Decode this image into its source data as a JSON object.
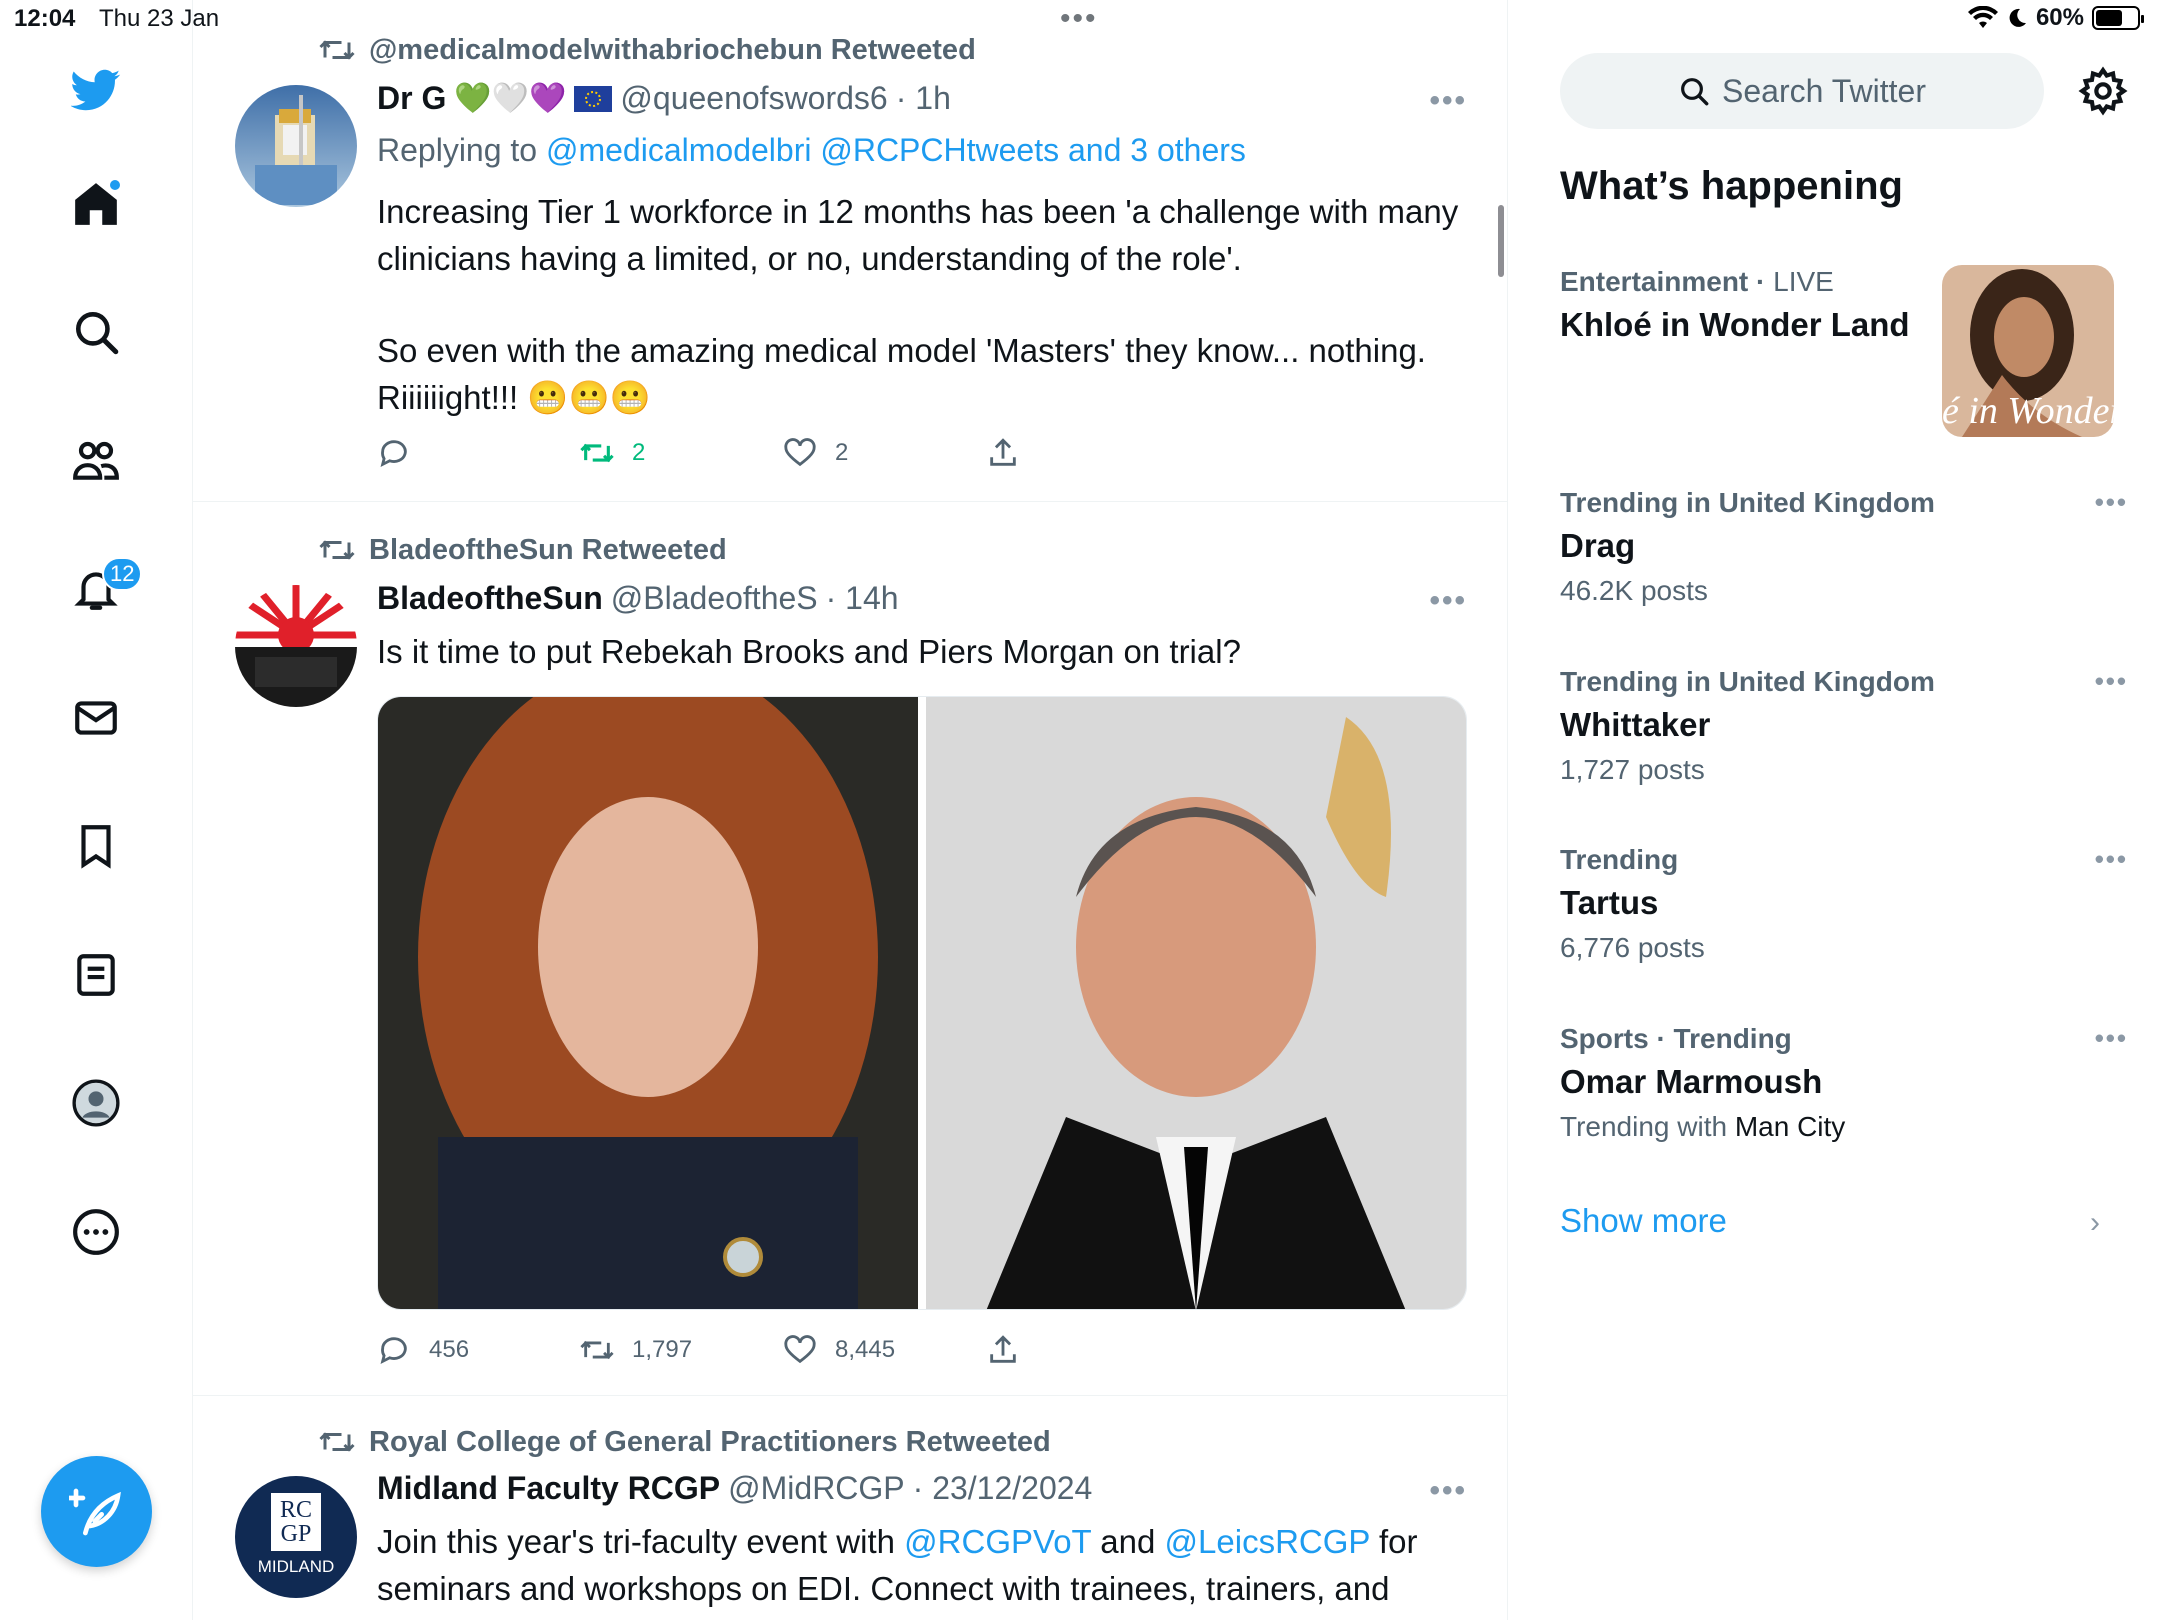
{
  "status_bar": {
    "time": "12:04",
    "date": "Thu 23 Jan",
    "battery": "60%"
  },
  "nav": {
    "notifications_badge": "12"
  },
  "tweets": [
    {
      "retweeted_by": "@medicalmodelwithabriochebun Retweeted",
      "name": "Dr G",
      "name_emoji": "💚🤍💜",
      "handle": "@queenofswords6",
      "time": "· 1h",
      "replying_prefix": "Replying to ",
      "replying_to": "@medicalmodelbri @RCPCHtweets and 3 others",
      "text_1": "Increasing Tier 1 workforce in 12 months has been 'a challenge with many clinicians having a limited, or no, understanding of the role'.",
      "text_2": "So even with the amazing medical model 'Masters' they know... nothing. Riiiiiight!!! 😬😬😬",
      "replies": "",
      "retweets": "2",
      "likes": "2"
    },
    {
      "retweeted_by": "BladeoftheSun Retweeted",
      "name": "BladeoftheSun",
      "handle": "@BladeoftheS",
      "time": "· 14h",
      "text": "Is it time to put Rebekah Brooks and Piers Morgan on trial?",
      "replies": "456",
      "retweets": "1,797",
      "likes": "8,445"
    },
    {
      "retweeted_by": "Royal College of General Practitioners Retweeted",
      "name": "Midland Faculty RCGP",
      "handle": "@MidRCGP",
      "time": "· 23/12/2024",
      "text_a": "Join this year's tri-faculty event with ",
      "mention_1": "@RCGPVoT",
      "text_b": " and ",
      "mention_2": "@LeicsRCGP",
      "text_c": " for seminars and workshops on EDI. Connect with trainees, trainers, and",
      "avatar_text_1": "RC",
      "avatar_text_2": "GP",
      "avatar_text_3": "MIDLAND"
    }
  ],
  "sidebar": {
    "search_placeholder": "Search Twitter",
    "whats_happening": "What’s happening",
    "trends": [
      {
        "context": "Entertainment · ",
        "context_live": "LIVE",
        "title": "Khloé in Wonder Land",
        "meta": ""
      },
      {
        "context": "Trending in United Kingdom",
        "title": "Drag",
        "meta": "46.2K posts"
      },
      {
        "context": "Trending in United Kingdom",
        "title": "Whittaker",
        "meta": "1,727 posts"
      },
      {
        "context": "Trending",
        "title": "Tartus",
        "meta": "6,776 posts"
      },
      {
        "context": "Sports · Trending",
        "title": "Omar Marmoush",
        "meta_prefix": "Trending with ",
        "meta_dark": "Man City"
      }
    ],
    "trend_image_text": "é in Wonder L",
    "show_more": "Show more"
  },
  "colors": {
    "accent": "#1d9bf0",
    "retweet_green": "#00ba7c",
    "secondary_text": "#536471"
  }
}
